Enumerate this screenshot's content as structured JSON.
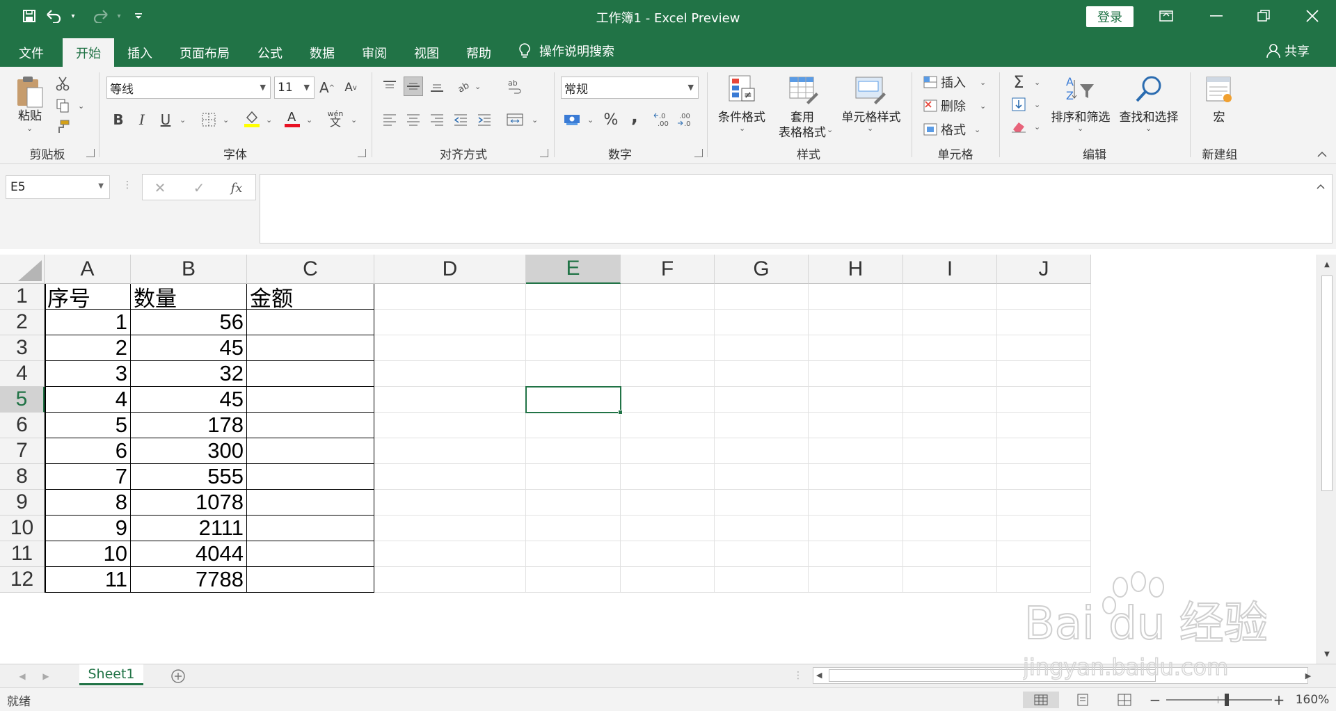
{
  "app": {
    "title": "工作簿1  -  Excel Preview",
    "login_label": "登录",
    "colors": {
      "accent": "#217346",
      "ribbon_bg": "#f3f3f3",
      "selection": "#217346"
    }
  },
  "quick_access": {
    "save_icon": "save-icon",
    "undo_icon": "undo-icon",
    "redo_icon": "redo-icon",
    "customize_icon": "customize-icon"
  },
  "tabs": [
    {
      "label": "文件"
    },
    {
      "label": "开始"
    },
    {
      "label": "插入"
    },
    {
      "label": "页面布局"
    },
    {
      "label": "公式"
    },
    {
      "label": "数据"
    },
    {
      "label": "审阅"
    },
    {
      "label": "视图"
    },
    {
      "label": "帮助"
    }
  ],
  "tell_me": "操作说明搜索",
  "share": "共享",
  "ribbon": {
    "clipboard": {
      "paste": "粘贴",
      "label": "剪贴板"
    },
    "font": {
      "font_name": "等线",
      "font_size": "11",
      "label": "字体",
      "phonetic": "wén"
    },
    "alignment": {
      "label": "对齐方式"
    },
    "number": {
      "format": "常规",
      "label": "数字",
      "percent": "%",
      "comma": ",",
      "inc_decimal": "←.0\n.00",
      "dec_decimal": ".00\n→.0"
    },
    "styles": {
      "conditional": "条件格式",
      "table_line1": "套用",
      "table_line2": "表格格式",
      "cell_styles": "单元格样式",
      "label": "样式"
    },
    "cells": {
      "insert": "插入",
      "delete": "删除",
      "format": "格式",
      "label": "单元格"
    },
    "editing": {
      "sort_filter": "排序和筛选",
      "find_select": "查找和选择",
      "label": "编辑"
    },
    "new_group": {
      "macro": "宏",
      "label": "新建组"
    }
  },
  "formula_bar": {
    "name_box": "E5",
    "cancel": "✕",
    "enter": "✓",
    "fx": "fx",
    "value": ""
  },
  "grid": {
    "columns": [
      "A",
      "B",
      "C",
      "D",
      "E",
      "F",
      "G",
      "H",
      "I",
      "J"
    ],
    "rows": [
      "1",
      "2",
      "3",
      "4",
      "5",
      "6",
      "7",
      "8",
      "9",
      "10",
      "11",
      "12"
    ],
    "selected_cell": "E5",
    "cells": {
      "A1": "序号",
      "B1": "数量",
      "C1": "金额",
      "A2": "1",
      "B2": "56",
      "A3": "2",
      "B3": "45",
      "A4": "3",
      "B4": "32",
      "A5": "4",
      "B5": "45",
      "A6": "5",
      "B6": "178",
      "A7": "6",
      "B7": "300",
      "A8": "7",
      "B8": "555",
      "A9": "8",
      "B9": "1078",
      "A10": "9",
      "B10": "2111",
      "A11": "10",
      "B11": "4044",
      "A12": "11",
      "B12": "7788"
    }
  },
  "sheets": [
    {
      "label": "Sheet1",
      "active": true
    }
  ],
  "status": {
    "ready": "就绪",
    "zoom": "160%",
    "zoom_minus": "−",
    "zoom_plus": "+"
  },
  "watermark": {
    "brand": "Bai du 经验",
    "domain": "jingyan.baidu.com"
  }
}
